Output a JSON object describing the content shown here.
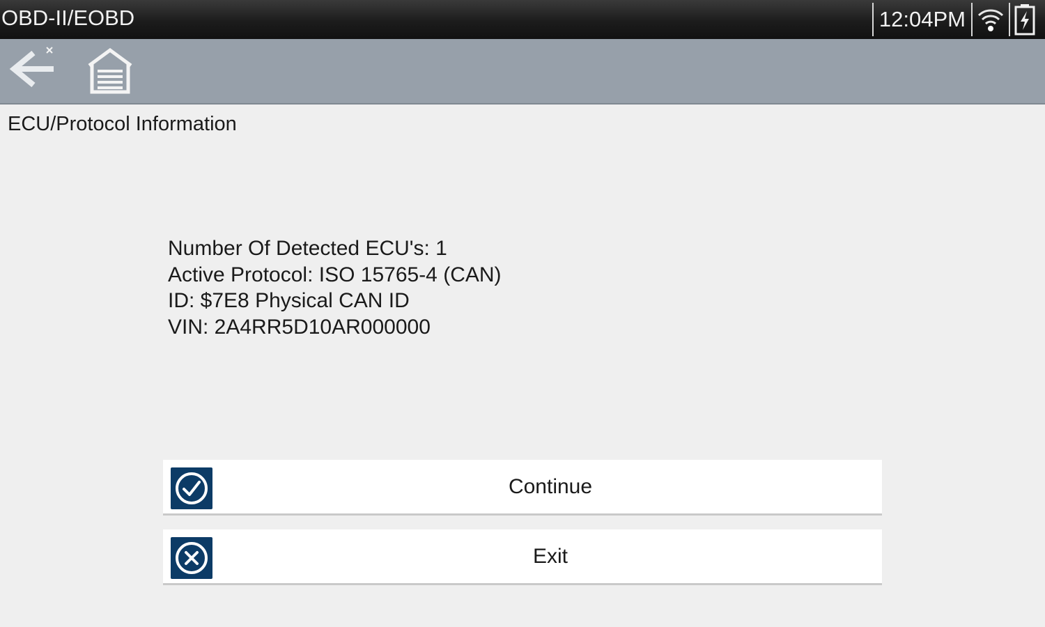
{
  "status_bar": {
    "title": "OBD-II/EOBD",
    "clock": "12:04PM",
    "wifi_icon": "wifi-icon",
    "battery_icon": "battery-charging-icon"
  },
  "toolbar": {
    "back_icon": "back-arrow-icon",
    "home_icon": "home-garage-icon"
  },
  "page": {
    "title": "ECU/Protocol Information"
  },
  "info": {
    "lines": [
      "Number Of Detected ECU's: 1",
      "Active Protocol: ISO 15765-4 (CAN)",
      "ID: $7E8 Physical CAN ID",
      "VIN: 2A4RR5D10AR000000"
    ]
  },
  "actions": {
    "continue_label": "Continue",
    "exit_label": "Exit"
  },
  "colors": {
    "accent": "#0c3b66",
    "toolbar": "#97a0aa",
    "background": "#efefef"
  }
}
